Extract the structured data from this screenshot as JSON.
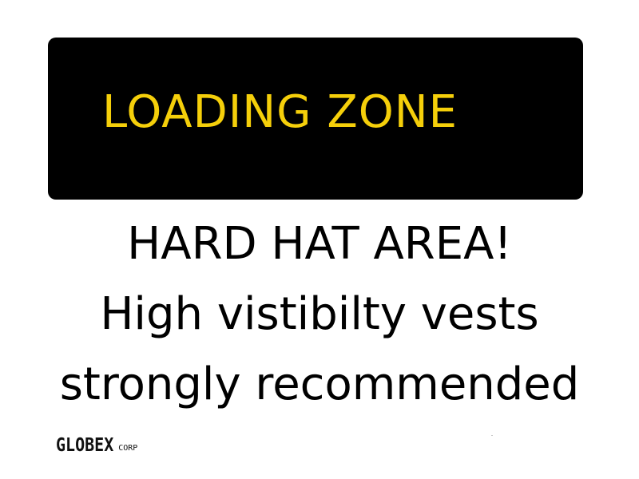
{
  "sign": {
    "header": "LOADING ZONE",
    "lines": [
      "HARD HAT AREA!",
      "High vistibilty vests",
      "strongly recommended"
    ]
  },
  "logo": {
    "main": "GLOBEX",
    "sub": "CORP"
  },
  "colors": {
    "banner_bg": "#000000",
    "banner_text": "#f5cf0a",
    "body_text": "#000000",
    "background": "#ffffff"
  }
}
